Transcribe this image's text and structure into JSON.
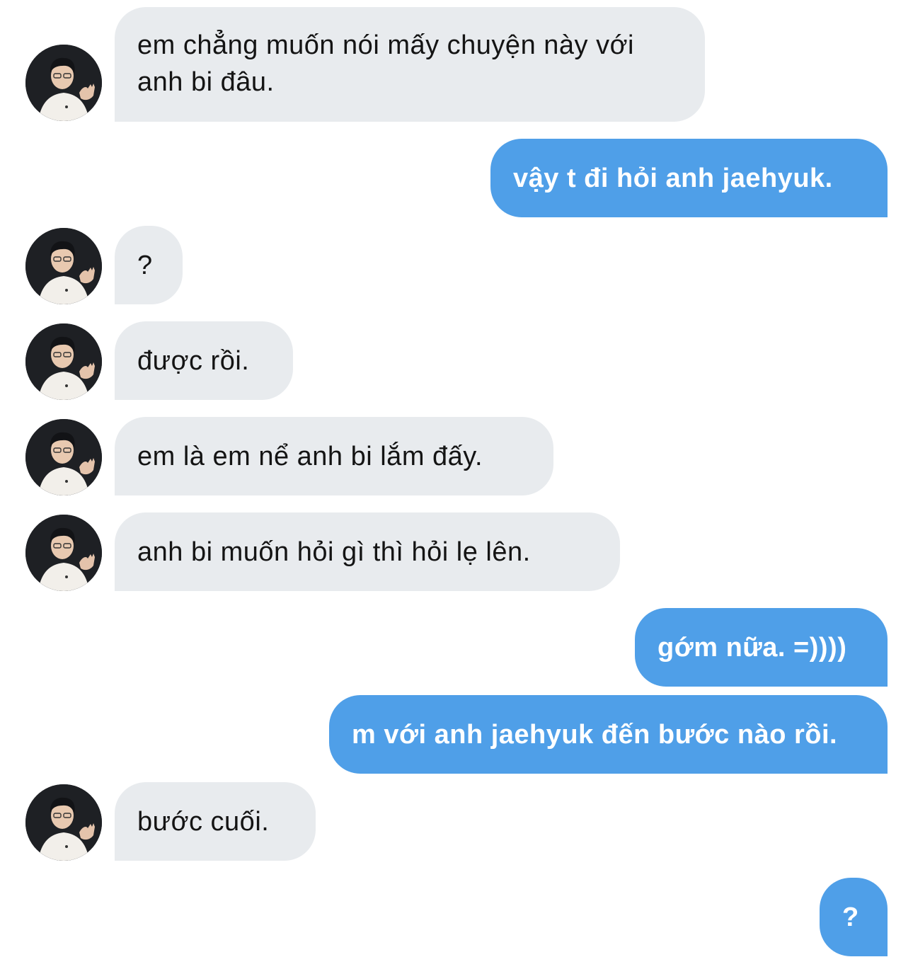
{
  "messages": [
    {
      "sender": "other",
      "text": "em chẳng muốn nói mấy chuyện này với anh bi đâu."
    },
    {
      "sender": "me",
      "text": "vậy t đi hỏi anh jaehyuk."
    },
    {
      "sender": "other",
      "text": "?"
    },
    {
      "sender": "other",
      "text": "được rồi."
    },
    {
      "sender": "other",
      "text": "em là em nể anh bi lắm đấy."
    },
    {
      "sender": "other",
      "text": "anh bi muốn hỏi gì thì hỏi lẹ lên."
    },
    {
      "sender": "me",
      "text": "gớm nữa. =))))"
    },
    {
      "sender": "me",
      "text": "m với anh jaehyuk đến bước nào rồi."
    },
    {
      "sender": "other",
      "text": "bước cuối."
    },
    {
      "sender": "me",
      "text": "?"
    }
  ],
  "colors": {
    "received_bubble": "#e8ebee",
    "sent_bubble": "#4f9fe8",
    "received_text": "#141414",
    "sent_text": "#ffffff"
  },
  "icons": {
    "avatar": "contact-avatar-photo"
  }
}
